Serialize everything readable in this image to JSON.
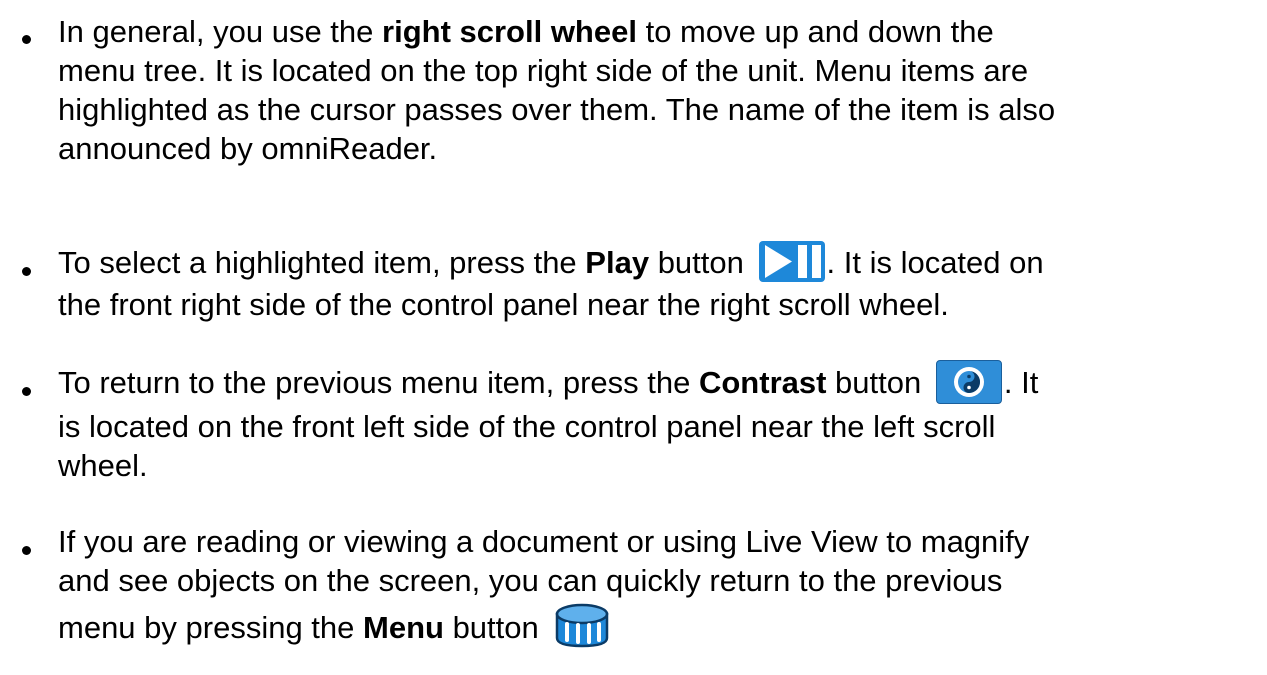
{
  "bullets": [
    {
      "lines": [
        [
          "In general, you use the ",
          "right scroll wheel",
          " to move up and down the"
        ],
        [
          "menu tree. It is located on the top right side of the unit. Menu items are"
        ],
        [
          "highlighted as the cursor passes over them. The name of the item is also"
        ],
        [
          "announced by omniReader."
        ]
      ]
    },
    {
      "line1_pre": "To select a highlighted item, press the ",
      "line1_bold": "Play",
      "line1_mid": " button ",
      "line1_post": ". It is located on",
      "line2": "the front right side of the control panel near the right scroll wheel.",
      "icon": "play-pause-icon"
    },
    {
      "line1_pre": "To return to the previous menu item, press the ",
      "line1_bold": "Contrast",
      "line1_mid": " button ",
      "line1_post": ". It",
      "line2": "is located on the front left side of the control panel near the left scroll",
      "line3": "wheel.",
      "icon": "contrast-icon"
    },
    {
      "line1": "If you are reading or viewing a document or using Live View to magnify",
      "line2": "and see objects on the screen, you can quickly return to the previous",
      "line3_pre": "menu by pressing the ",
      "line3_bold": "Menu",
      "line3_mid": " button ",
      "icon": "menu-knob-icon"
    }
  ],
  "colors": {
    "text": "#000000",
    "icon_blue": "#1e88d9",
    "icon_dark": "#0b3b66"
  }
}
